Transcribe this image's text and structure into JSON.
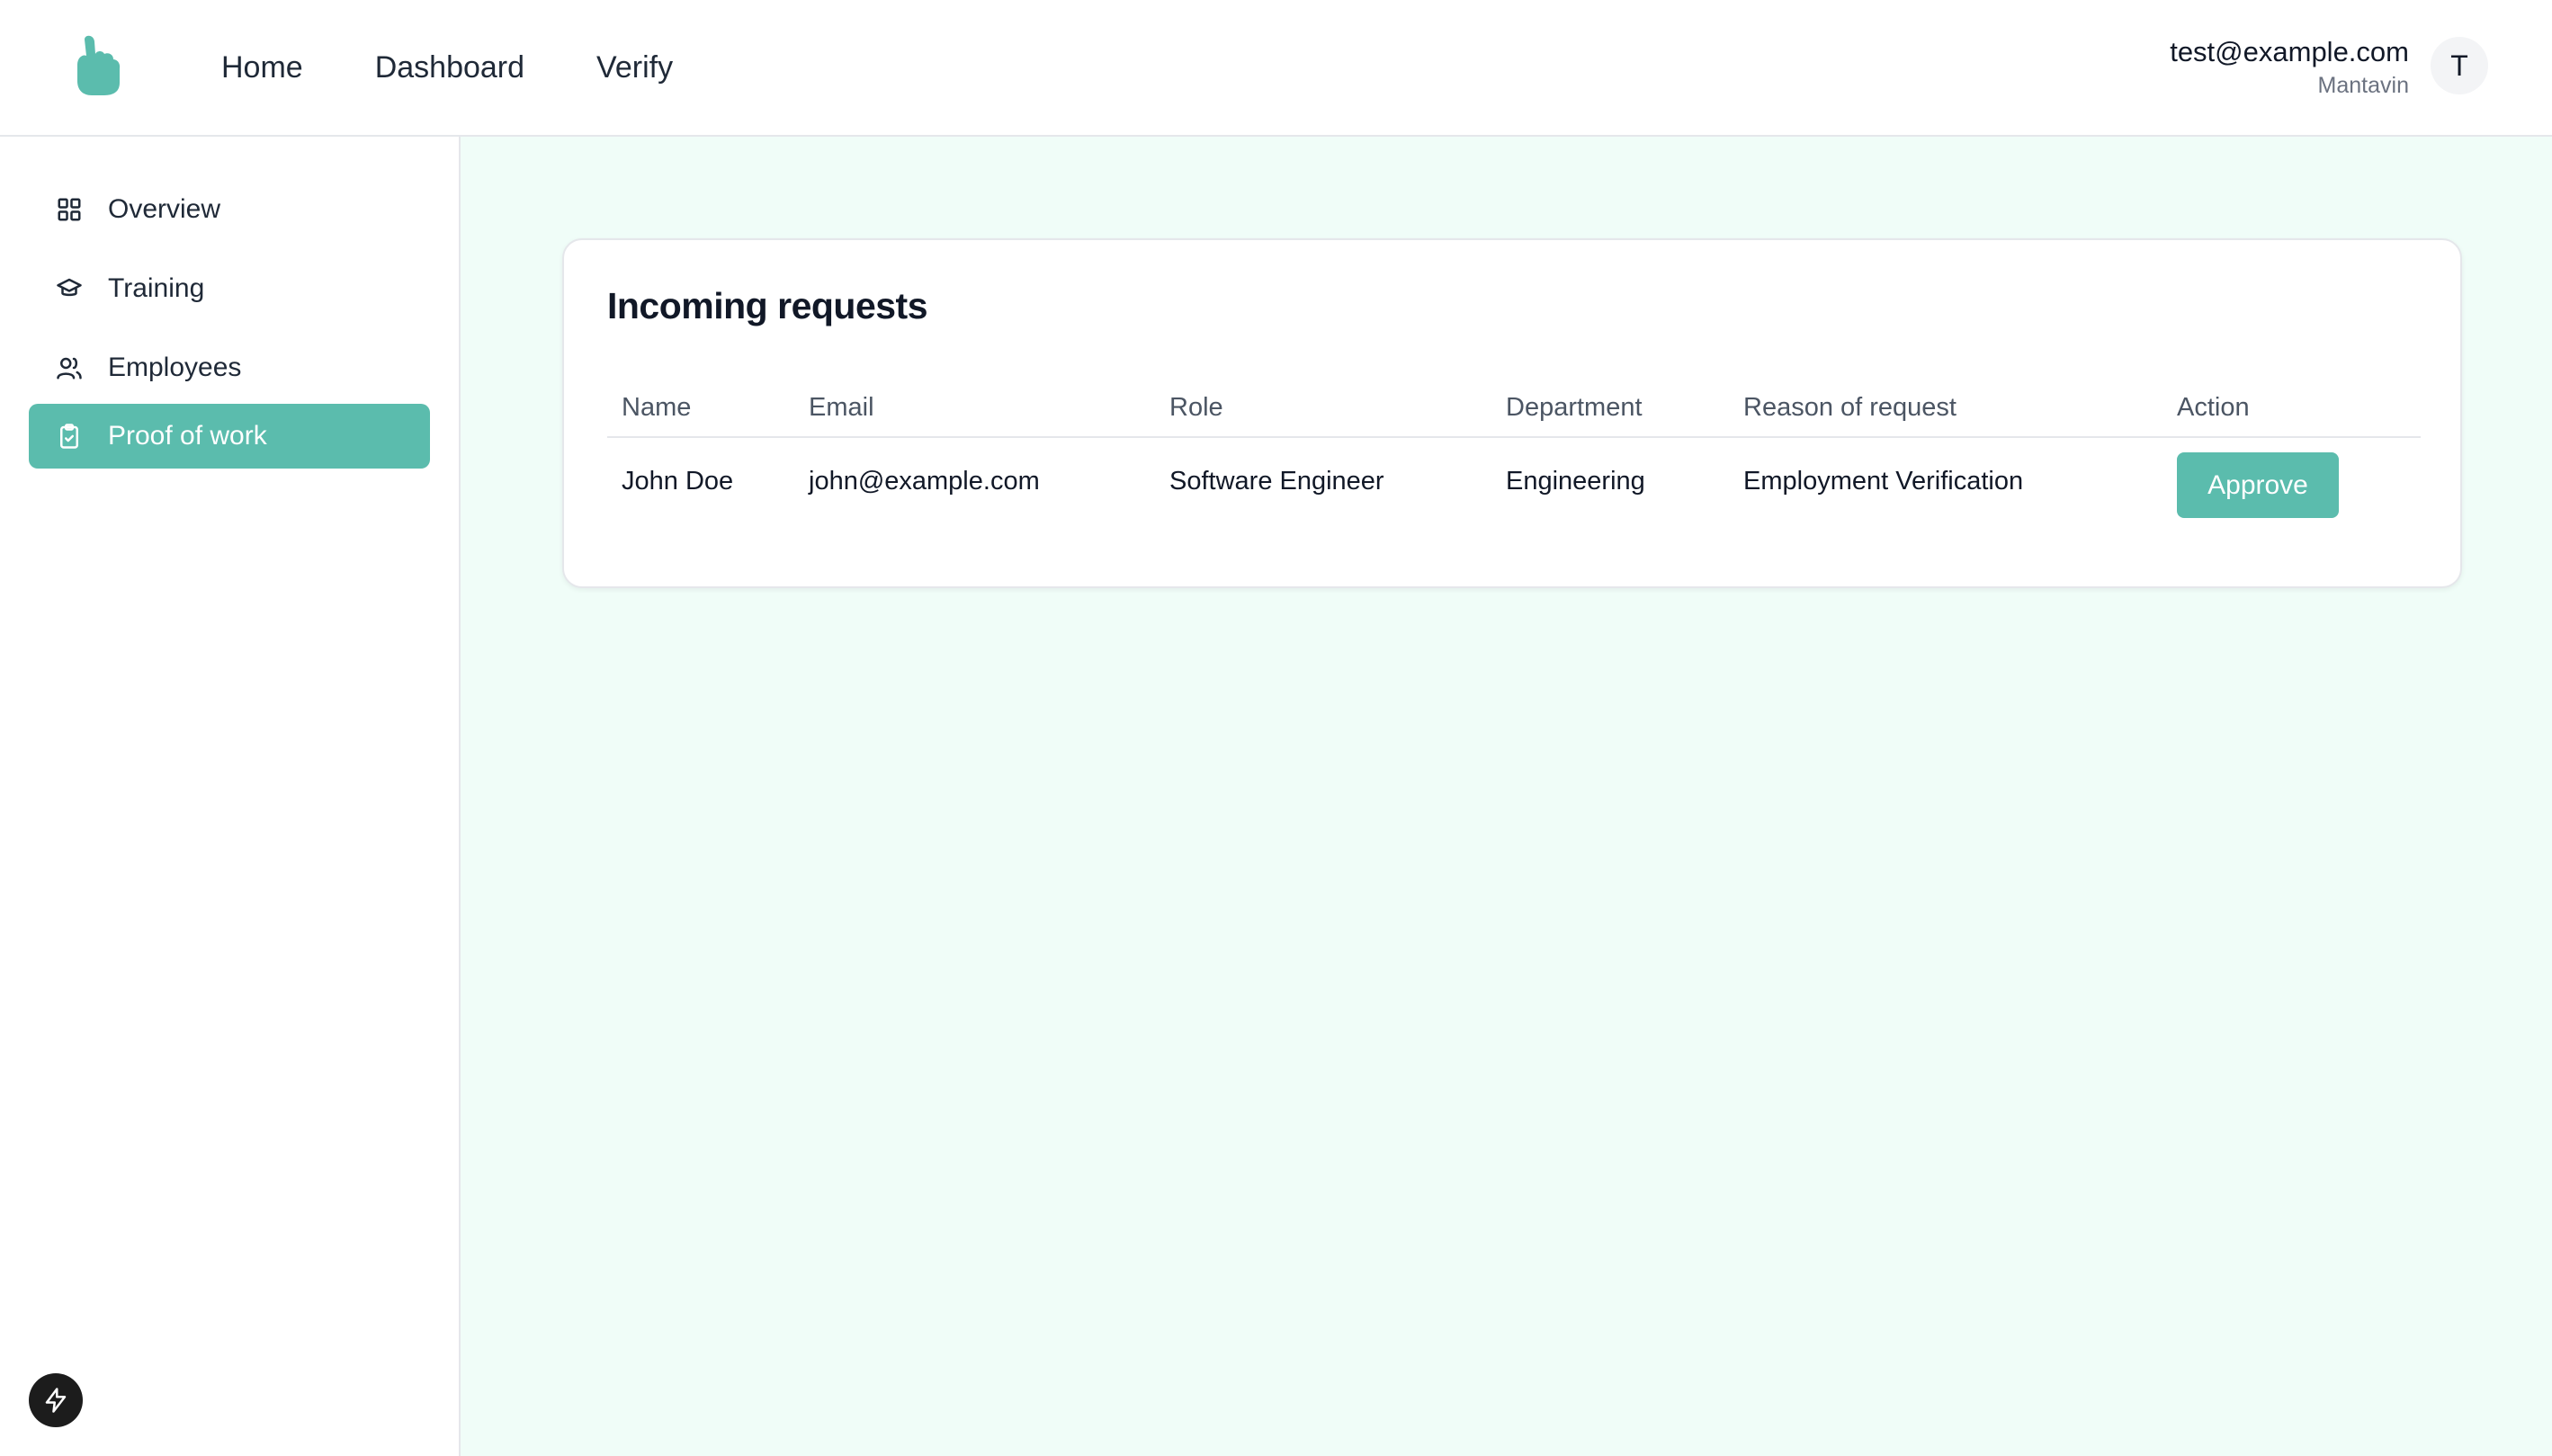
{
  "header": {
    "logo_icon": "thumbs-up-hand-logo",
    "nav": [
      "Home",
      "Dashboard",
      "Verify"
    ],
    "user_email": "test@example.com",
    "user_org": "Mantavin",
    "avatar_initial": "T"
  },
  "sidebar": {
    "items": [
      {
        "label": "Overview",
        "icon": "grid-icon"
      },
      {
        "label": "Training",
        "icon": "graduation-cap-icon"
      },
      {
        "label": "Employees",
        "icon": "users-icon"
      },
      {
        "label": "Proof of work",
        "icon": "clipboard-check-icon",
        "active": true
      }
    ],
    "bolt_icon": "lightning-bolt-icon"
  },
  "main": {
    "card_title": "Incoming requests",
    "columns": [
      "Name",
      "Email",
      "Role",
      "Department",
      "Reason of request",
      "Action"
    ],
    "rows": [
      {
        "name": "John Doe",
        "email": "john@example.com",
        "role": "Software Engineer",
        "department": "Engineering",
        "reason": "Employment Verification",
        "action": "Approve"
      }
    ]
  },
  "colors": {
    "accent": "#5bbcad",
    "main_bg": "#f0fdf8",
    "bolt_bg": "#1c1c1c"
  }
}
